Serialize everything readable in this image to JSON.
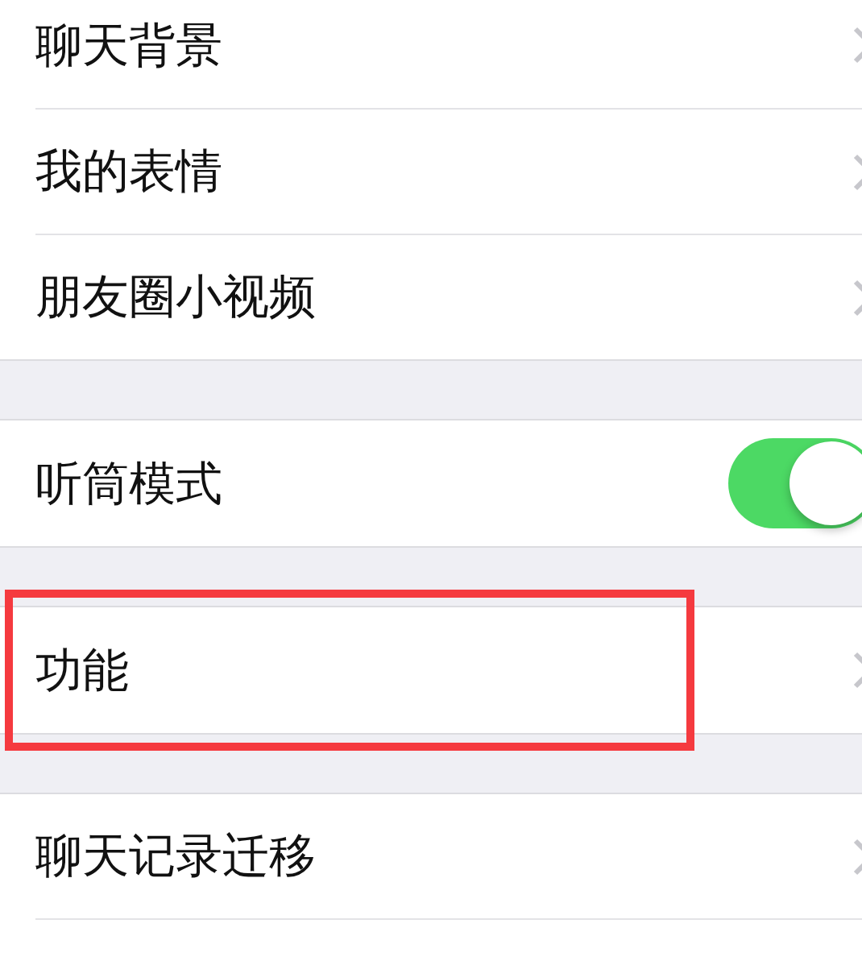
{
  "groups": [
    {
      "items": [
        {
          "label": "聊天背景",
          "kind": "link"
        },
        {
          "label": "我的表情",
          "kind": "link"
        },
        {
          "label": "朋友圈小视频",
          "kind": "link"
        }
      ]
    },
    {
      "items": [
        {
          "label": "听筒模式",
          "kind": "toggle",
          "on": true
        }
      ]
    },
    {
      "items": [
        {
          "label": "功能",
          "kind": "link",
          "highlighted": true
        }
      ]
    },
    {
      "items": [
        {
          "label": "聊天记录迁移",
          "kind": "link"
        }
      ]
    }
  ]
}
